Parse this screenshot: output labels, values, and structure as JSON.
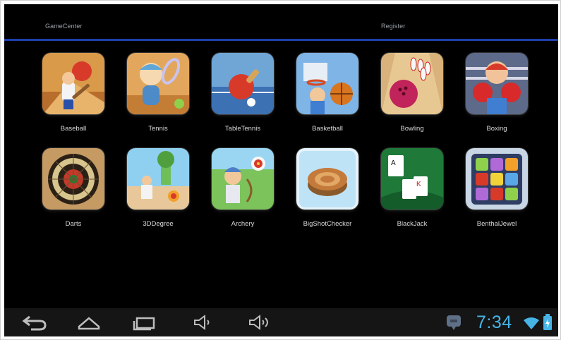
{
  "header": {
    "tabs": [
      {
        "label": "GameCenter"
      },
      {
        "label": "Register"
      }
    ]
  },
  "games": [
    {
      "label": "Baseball",
      "icon": "baseball-icon"
    },
    {
      "label": "Tennis",
      "icon": "tennis-icon"
    },
    {
      "label": "TableTennis",
      "icon": "table-tennis-icon"
    },
    {
      "label": "Basketball",
      "icon": "basketball-icon"
    },
    {
      "label": "Bowling",
      "icon": "bowling-icon"
    },
    {
      "label": "Boxing",
      "icon": "boxing-icon"
    },
    {
      "label": "Darts",
      "icon": "darts-icon"
    },
    {
      "label": "3DDegree",
      "icon": "3ddegree-icon"
    },
    {
      "label": "Archery",
      "icon": "archery-icon"
    },
    {
      "label": "BigShotChecker",
      "icon": "checker-icon"
    },
    {
      "label": "BlackJack",
      "icon": "blackjack-icon"
    },
    {
      "label": "BenthalJewel",
      "icon": "jewel-icon"
    }
  ],
  "navbar": {
    "buttons": [
      "back-icon",
      "home-icon",
      "recent-apps-icon",
      "volume-down-icon",
      "volume-up-icon"
    ],
    "status": {
      "time": "7:34",
      "icons": [
        "notification-icon",
        "wifi-icon",
        "battery-icon"
      ]
    }
  },
  "colors": {
    "screen_bg": "#000000",
    "header_line": "#1f3fae",
    "navbar_bg": "#151515",
    "clock": "#46b5e6",
    "tab_text": "#9aa0a8",
    "label_text": "#d9d9d9"
  }
}
